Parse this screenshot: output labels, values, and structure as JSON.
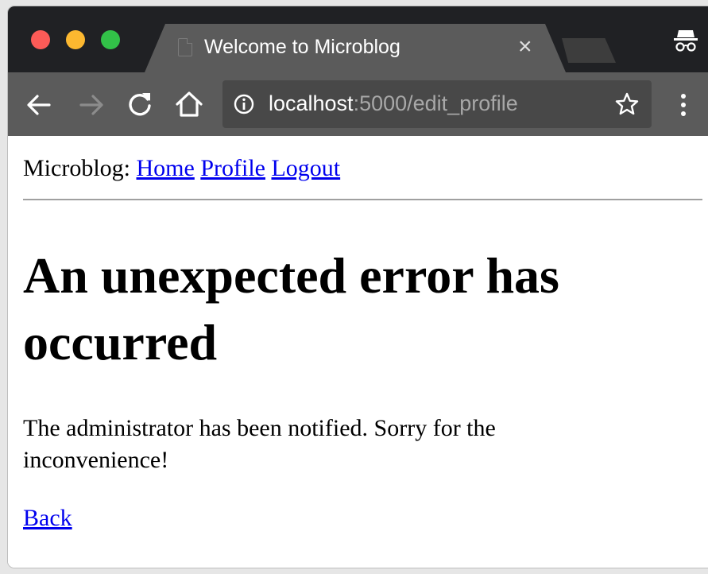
{
  "browser": {
    "tab": {
      "title": "Welcome to Microblog",
      "close_label": "×"
    },
    "address": {
      "host": "localhost",
      "rest": ":5000/edit_profile"
    },
    "icons": {
      "back": "arrow-left-icon",
      "forward": "arrow-right-icon",
      "reload": "reload-icon",
      "home": "home-icon",
      "info": "info-icon",
      "bookmark": "star-icon",
      "menu": "kebab-menu-icon",
      "incognito": "incognito-icon"
    },
    "colors": {
      "tabbar": "#202124",
      "toolbar": "#5b5b5b",
      "close": "#fc5b57",
      "minimize": "#fcb830",
      "maximize": "#32c148"
    }
  },
  "page": {
    "nav": {
      "prefix": "Microblog:",
      "links": [
        "Home",
        "Profile",
        "Logout"
      ]
    },
    "heading": "An unexpected error has occurred",
    "message": "The administrator has been notified. Sorry for the inconvenience!",
    "back_link": "Back",
    "link_color": "#0000ee"
  }
}
